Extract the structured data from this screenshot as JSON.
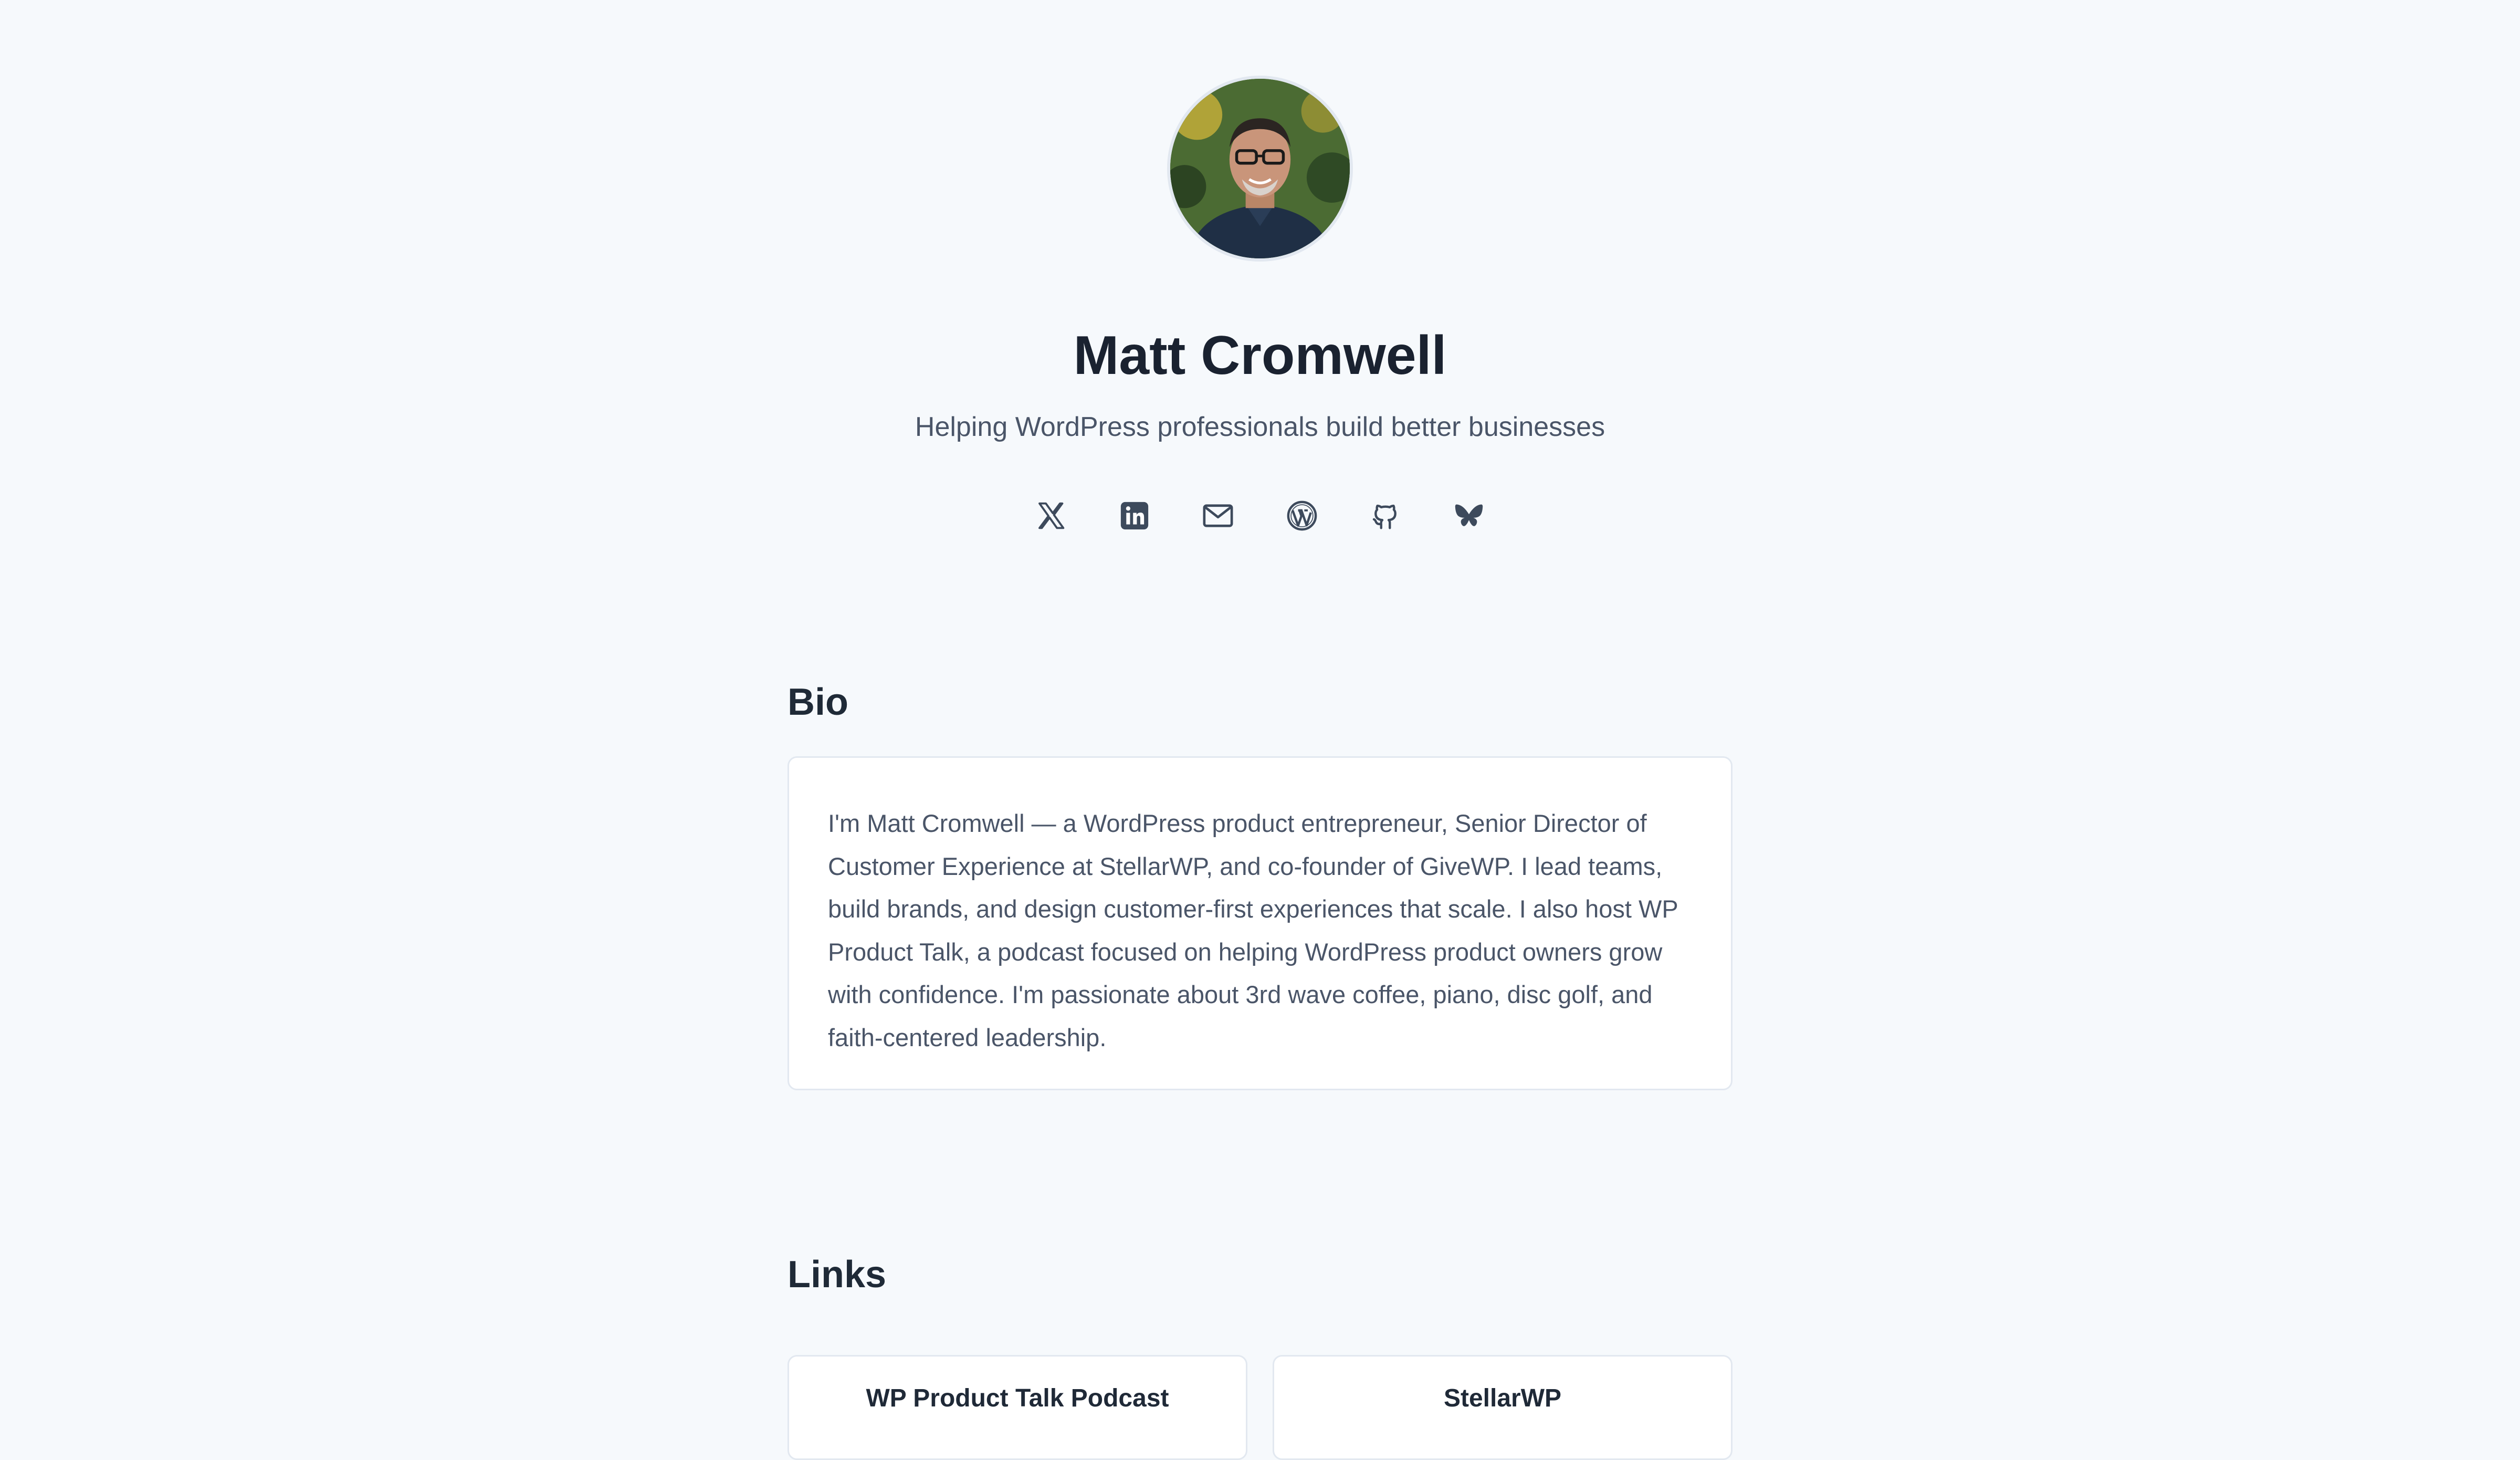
{
  "profile": {
    "name": "Matt Cromwell",
    "tagline": "Helping WordPress professionals build better businesses"
  },
  "socials": [
    {
      "icon": "x-twitter-icon",
      "label": "X"
    },
    {
      "icon": "linkedin-icon",
      "label": "LinkedIn"
    },
    {
      "icon": "mail-icon",
      "label": "Email"
    },
    {
      "icon": "wordpress-icon",
      "label": "WordPress"
    },
    {
      "icon": "github-icon",
      "label": "GitHub"
    },
    {
      "icon": "bluesky-icon",
      "label": "Bluesky"
    }
  ],
  "bio": {
    "heading": "Bio",
    "text": "I'm Matt Cromwell — a WordPress product entrepreneur, Senior Director of Customer Experience at StellarWP, and co-founder of GiveWP. I lead teams, build brands, and design customer-first experiences that scale. I also host WP Product Talk, a podcast focused on helping WordPress product owners grow with confidence. I'm passionate about 3rd wave coffee, piano, disc golf, and faith-centered leadership."
  },
  "links": {
    "heading": "Links",
    "items": [
      {
        "label": "WP Product Talk Podcast"
      },
      {
        "label": "StellarWP"
      }
    ]
  },
  "colors": {
    "background": "#f6f9fc",
    "text": "#1a2230",
    "muted": "#4a5568",
    "icon": "#3d4a5c",
    "card_border": "#e2e8f0"
  }
}
